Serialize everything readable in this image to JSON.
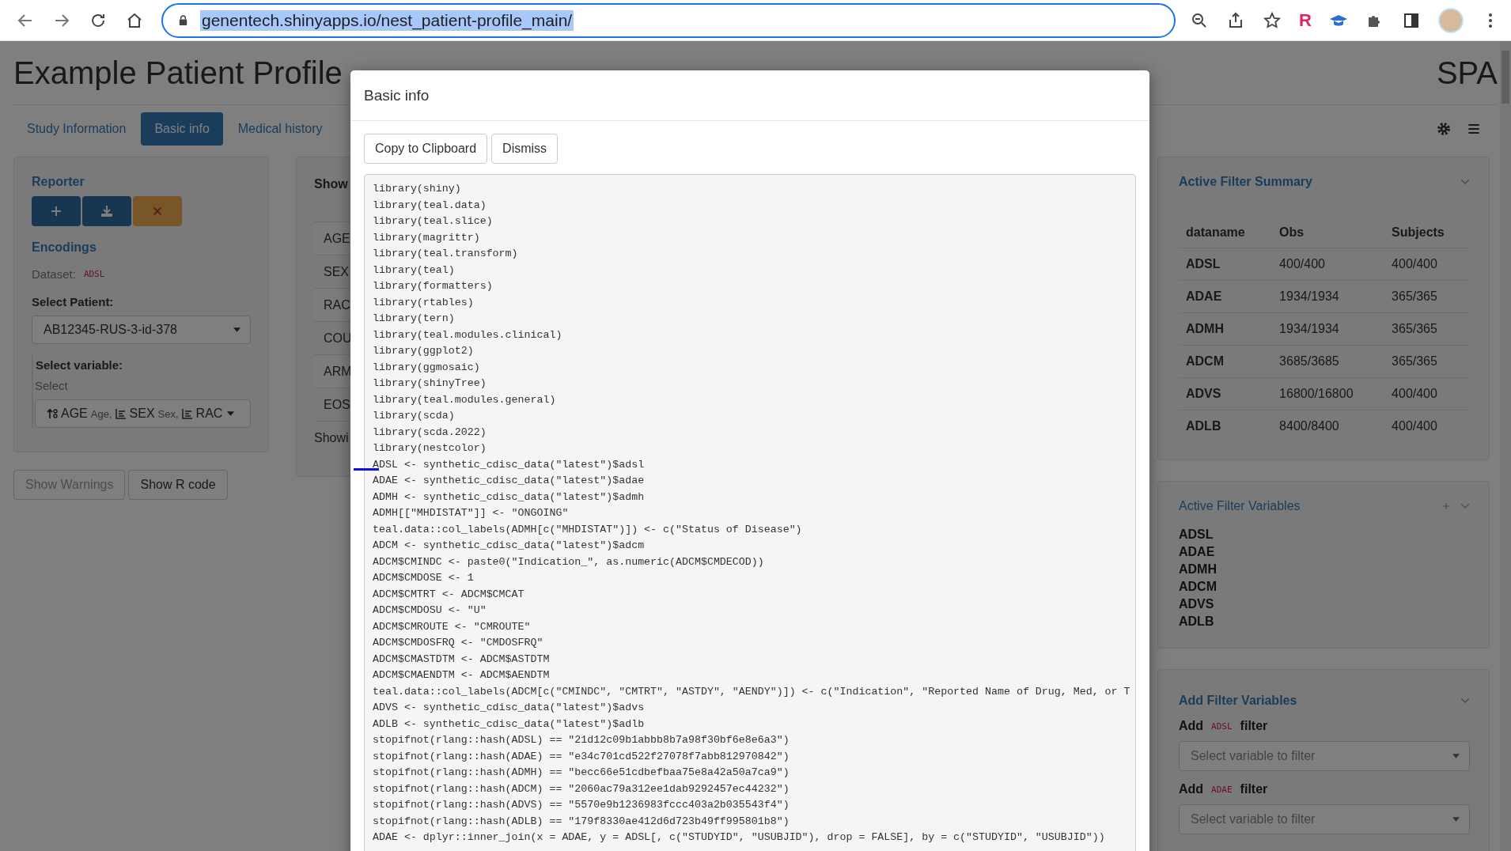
{
  "browser": {
    "url": "genentech.shinyapps.io/nest_patient-profile_main/",
    "url_selected": true,
    "extension_letter": "R"
  },
  "header": {
    "title": "Example Patient Profile",
    "brand": "SPA"
  },
  "tabs": [
    {
      "label": "Study Information",
      "selected": false
    },
    {
      "label": "Basic info",
      "selected": true
    },
    {
      "label": "Medical history",
      "selected": false
    }
  ],
  "encodings_panel": {
    "reporter_title": "Reporter",
    "encodings_title": "Encodings",
    "dataset_label": "Dataset:",
    "dataset": "ADSL",
    "patient_label": "Select Patient:",
    "patient_value": "AB12345-RUS-3-id-378",
    "variable_label": "Select variable:",
    "variable_hint": "Select",
    "variables": [
      {
        "kind": "numeric",
        "name": "AGE",
        "label": "Age,"
      },
      {
        "kind": "factor",
        "name": "SEX",
        "label": "Sex,"
      },
      {
        "kind": "factor",
        "name": "RAC"
      }
    ]
  },
  "bottom_buttons": [
    {
      "label": "Show Warnings",
      "disabled": true
    },
    {
      "label": "Show R code",
      "disabled": false
    }
  ],
  "table_panel": {
    "title": "Show",
    "rows": [
      "AGE",
      "SEX",
      "RAC",
      "COU",
      "ARM",
      "EOS"
    ],
    "footer": "Showi"
  },
  "filter_summary": {
    "title": "Active Filter Summary",
    "columns": [
      "dataname",
      "Obs",
      "Subjects"
    ],
    "rows": [
      [
        "ADSL",
        "400/400",
        "400/400"
      ],
      [
        "ADAE",
        "1934/1934",
        "365/365"
      ],
      [
        "ADMH",
        "1934/1934",
        "365/365"
      ],
      [
        "ADCM",
        "3685/3685",
        "365/365"
      ],
      [
        "ADVS",
        "16800/16800",
        "400/400"
      ],
      [
        "ADLB",
        "8400/8400",
        "400/400"
      ]
    ]
  },
  "active_variables": {
    "title": "Active Filter Variables",
    "items": [
      "ADSL",
      "ADAE",
      "ADMH",
      "ADCM",
      "ADVS",
      "ADLB"
    ]
  },
  "add_variables": {
    "title": "Add Filter Variables",
    "filters": [
      {
        "prefix": "Add",
        "dataset": "ADSL",
        "suffix": "filter",
        "placeholder": "Select variable to filter"
      },
      {
        "prefix": "Add",
        "dataset": "ADAE",
        "suffix": "filter",
        "placeholder": "Select variable to filter"
      }
    ]
  },
  "modal": {
    "title": "Basic info",
    "buttons": [
      "Copy to Clipboard",
      "Dismiss"
    ],
    "code": [
      "library(shiny)",
      "library(teal.data)",
      "library(teal.slice)",
      "library(magrittr)",
      "library(teal.transform)",
      "library(teal)",
      "library(formatters)",
      "library(rtables)",
      "library(tern)",
      "library(teal.modules.clinical)",
      "library(ggplot2)",
      "library(ggmosaic)",
      "library(shinyTree)",
      "library(teal.modules.general)",
      "library(scda)",
      "library(scda.2022)",
      "library(nestcolor)",
      "ADSL <- synthetic_cdisc_data(\"latest\")$adsl",
      "ADAE <- synthetic_cdisc_data(\"latest\")$adae",
      "ADMH <- synthetic_cdisc_data(\"latest\")$admh",
      "ADMH[[\"MHDISTAT\"]] <- \"ONGOING\"",
      "teal.data::col_labels(ADMH[c(\"MHDISTAT\")]) <- c(\"Status of Disease\")",
      "ADCM <- synthetic_cdisc_data(\"latest\")$adcm",
      "ADCM$CMINDC <- paste0(\"Indication_\", as.numeric(ADCM$CMDECOD))",
      "ADCM$CMDOSE <- 1",
      "ADCM$CMTRT <- ADCM$CMCAT",
      "ADCM$CMDOSU <- \"U\"",
      "ADCM$CMROUTE <- \"CMROUTE\"",
      "ADCM$CMDOSFRQ <- \"CMDOSFRQ\"",
      "ADCM$CMASTDTM <- ADCM$ASTDTM",
      "ADCM$CMAENDTM <- ADCM$AENDTM",
      "teal.data::col_labels(ADCM[c(\"CMINDC\", \"CMTRT\", \"ASTDY\", \"AENDY\")]) <- c(\"Indication\", \"Reported Name of Drug, Med, or T",
      "ADVS <- synthetic_cdisc_data(\"latest\")$advs",
      "ADLB <- synthetic_cdisc_data(\"latest\")$adlb",
      "stopifnot(rlang::hash(ADSL) == \"21d12c09b1abbb8b7a98f30bf6e8e6a3\")",
      "stopifnot(rlang::hash(ADAE) == \"e34c701cd522f27078f7abb812970842\")",
      "stopifnot(rlang::hash(ADMH) == \"becc66e51cdbefbaa75e8a42a50a7ca9\")",
      "stopifnot(rlang::hash(ADCM) == \"2060ac79a312ee1dab9292457ec44232\")",
      "stopifnot(rlang::hash(ADVS) == \"5570e9b1236983fccc403a2b035543f4\")",
      "stopifnot(rlang::hash(ADLB) == \"179f8330ae412d6d723b49ff995801b8\")",
      "ADAE <- dplyr::inner_join(x = ADAE, y = ADSL[, c(\"STUDYID\", \"USUBJID\"), drop = FALSE], by = c(\"STUDYID\", \"USUBJID\"))"
    ]
  }
}
